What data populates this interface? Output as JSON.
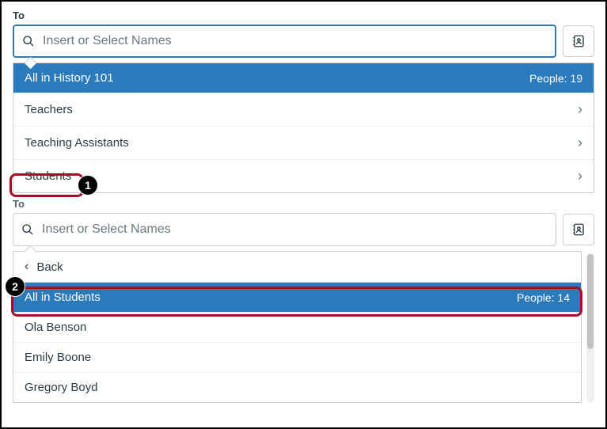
{
  "section1": {
    "label": "To",
    "placeholder": "Insert or Select Names",
    "dropdown": {
      "selected": {
        "label": "All in History 101",
        "people_label": "People: 19"
      },
      "items": [
        {
          "label": "Teachers"
        },
        {
          "label": "Teaching Assistants"
        },
        {
          "label": "Students"
        }
      ]
    }
  },
  "section2": {
    "label": "To",
    "placeholder": "Insert or Select Names",
    "dropdown": {
      "back_label": "Back",
      "selected": {
        "label": "All in Students",
        "people_label": "People: 14"
      },
      "items": [
        {
          "label": "Ola Benson"
        },
        {
          "label": "Emily Boone"
        },
        {
          "label": "Gregory Boyd"
        }
      ]
    }
  },
  "annotations": {
    "badge1": "1",
    "badge2": "2"
  }
}
